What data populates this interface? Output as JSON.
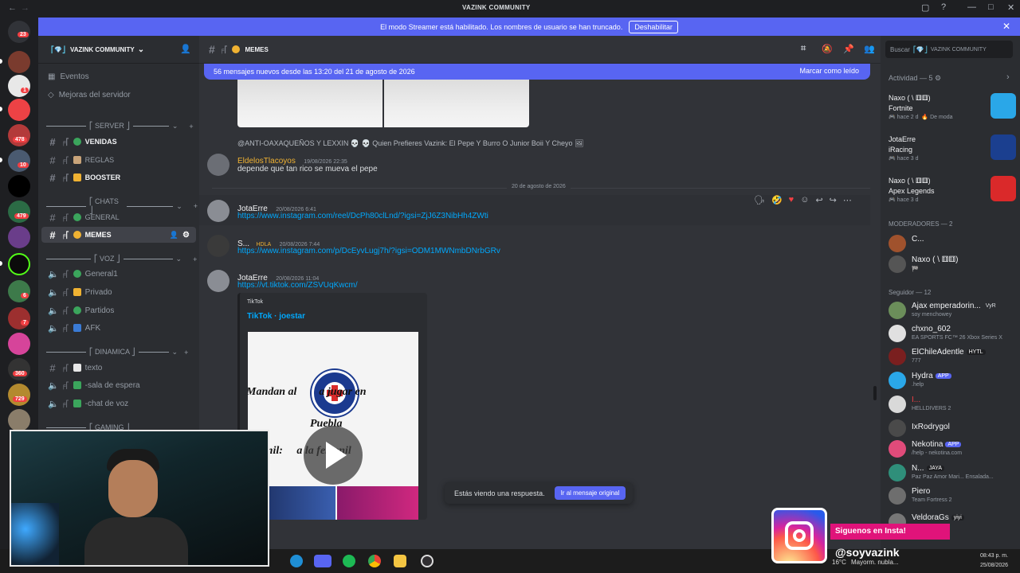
{
  "window": {
    "title": "VAZINK COMMUNITY",
    "controls": [
      "▢",
      "?",
      "—",
      "□",
      "✕"
    ]
  },
  "banner": {
    "text": "El modo Streamer está habilitado. Los nombres de usuario se han truncado.",
    "button": "Deshabilitar",
    "close": "✕"
  },
  "rail": {
    "badges": [
      "23",
      "1",
      "478",
      "10",
      "479",
      "6",
      "7",
      "360",
      "729"
    ]
  },
  "server": {
    "name": "VAZINK COMMUNITY",
    "deco": "⎡💎⎦",
    "chevron": "⌄",
    "top_items": [
      "Eventos",
      "Mejoras del servidor"
    ],
    "categories": [
      {
        "name": "⎡ SERVER ⎦",
        "channels": [
          {
            "name": "VENIDAS",
            "bold": true
          },
          {
            "name": "REGLAS",
            "bold": false
          },
          {
            "name": "BOOSTER",
            "bold": true
          }
        ]
      },
      {
        "name": "⎡ CHATS ⎦",
        "channels": [
          {
            "name": "GENERAL",
            "bold": false
          },
          {
            "name": "MEMES",
            "bold": true,
            "active": true
          }
        ]
      },
      {
        "name": "⎡ VOZ ⎦",
        "channels": [
          {
            "name": "General1"
          },
          {
            "name": "Privado"
          },
          {
            "name": "Partidos"
          },
          {
            "name": "AFK"
          }
        ]
      },
      {
        "name": "⎡ DINAMICA ⎦",
        "channels": [
          {
            "name": "texto"
          },
          {
            "name": "-sala de espera"
          },
          {
            "name": "-chat de voz"
          }
        ]
      },
      {
        "name": "⎡ GAMING ⎦",
        "channels": []
      }
    ]
  },
  "channel": {
    "name": "MEMES",
    "new_messages": "56 mensajes nuevos desde las 13:20 del 21 de agosto de 2026",
    "mark_read": "Marcar como leído",
    "search_placeholder": "Buscar",
    "search_scope": "VAZINK COMMUNITY"
  },
  "messages": [
    {
      "reply_to": "@ANTI-OAXAQUEÑOS Y LEXXIN 💀 💀 Quien Prefieres Vazink:  El Pepe Y Burro O Junior Boii Y Cheyo",
      "author": "EldelosTlacoyos",
      "author_color": "#f0b232",
      "time": "19/08/2026 22:35",
      "text": "depende que tan rico se mueva el pepe"
    },
    {
      "divider": "20 de agosto de 2026"
    },
    {
      "author": "JotaErre",
      "time": "20/08/2026 6:41",
      "link": "https://www.instagram.com/reel/DcPh80clLnd/?igsi=ZjJ6Z3NibHh4ZWti"
    },
    {
      "author": "S...",
      "tag": "HDLA",
      "time": "20/08/2026 7:44",
      "link": "https://www.instagram.com/p/DcEyvLugj7h/?igsi=ODM1MWNmbDNrbGRv"
    },
    {
      "author": "JotaErre",
      "time": "20/08/2026 11:04",
      "link": "https://vt.tiktok.com/ZSVUqKwcm/",
      "embed": {
        "provider": "TikTok",
        "title": "TikTok · joestar",
        "caption_top": "Mandan al        a jugar en",
        "caption_mid": "Puebla",
        "caption_bottom": "varonil:     a la femenil"
      }
    }
  ],
  "reply_bar": {
    "text": "Estás viendo una respuesta.",
    "button": "Ir al mensaje original"
  },
  "activity": {
    "header": "Actividad — 5",
    "cards": [
      {
        "name": "Naxo ( \\ ⚅⚅)",
        "game": "Fortnite",
        "meta": "hace 2 d",
        "extra": "De moda",
        "color": "#2aa7e8"
      },
      {
        "name": "JotaErre",
        "game": "iRacing",
        "meta": "hace 3 d",
        "extra": "",
        "color": "#1b3f8f"
      },
      {
        "name": "Naxo ( \\ ⚅⚅)",
        "game": "Apex Legends",
        "meta": "hace 3 d",
        "extra": "",
        "color": "#da292a"
      }
    ]
  },
  "members": {
    "groups": [
      {
        "name": "MODERADORES — 2",
        "items": [
          {
            "name": "C...",
            "status": ""
          },
          {
            "name": "Naxo ( \\ ⚅⚅)",
            "status": "🏁"
          }
        ]
      },
      {
        "name": "Seguidor — 12",
        "items": [
          {
            "name": "Ajax emperadorin...",
            "tag": "VyR",
            "status": "soy menchowey"
          },
          {
            "name": "chxno_602",
            "status": "EA SPORTS FC™ 26 Xbox Series X"
          },
          {
            "name": "ElChileAdentle",
            "tag": "HYTL",
            "status": "777"
          },
          {
            "name": "Hydra",
            "tag": "APP",
            "status": ".help"
          },
          {
            "name": "I...",
            "status": "HELLDIVERS 2"
          },
          {
            "name": "IxRodrygol",
            "status": ""
          },
          {
            "name": "Nekotina",
            "tag": "APP",
            "status": "/help - nekotina.com"
          },
          {
            "name": "N...",
            "tag": "JAYA",
            "status": "Paz Paz Amor Mari... Ensalada..."
          },
          {
            "name": "Piero",
            "status": "Team Fortress 2"
          },
          {
            "name": "VeldoraGs",
            "tag": "yiyi",
            "status": ""
          }
        ]
      }
    ]
  },
  "overlay": {
    "insta_title": "Siguenos en Insta!",
    "insta_handle": "@soyvazink"
  },
  "taskbar": {
    "weather": "16°C",
    "weather_text": "Mayorm. nubla...",
    "time": "08:43 p. m.",
    "date": "25/08/2026"
  }
}
